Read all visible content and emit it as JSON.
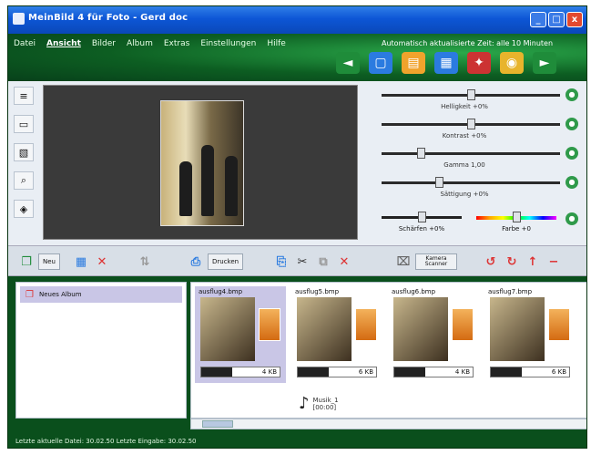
{
  "window": {
    "title": "MeinBild 4 für Foto - Gerd doc",
    "minimize": "_",
    "maximize": "□",
    "close": "x"
  },
  "menu": [
    "Datei",
    "Ansicht",
    "Bilder",
    "Album",
    "Extras",
    "Einstellungen",
    "Hilfe"
  ],
  "menu_selected_index": 1,
  "status": "Automatisch aktualisierte Zeit: alle 10 Minuten",
  "top_tools": [
    {
      "icon": "back-arrow-icon",
      "color": "#1f8c3a"
    },
    {
      "icon": "document-icon",
      "color": "#2b7be0"
    },
    {
      "icon": "folder-icon",
      "color": "#f0a32c"
    },
    {
      "icon": "image-icon",
      "color": "#2b7be0"
    },
    {
      "icon": "tools-icon",
      "color": "#cc3333"
    },
    {
      "icon": "disc-icon",
      "color": "#e8b42c"
    },
    {
      "icon": "forward-arrow-icon",
      "color": "#1f8c3a"
    }
  ],
  "left_tools": [
    {
      "icon": "list-icon"
    },
    {
      "icon": "picture-icon"
    },
    {
      "icon": "scan-icon"
    },
    {
      "icon": "magnify-icon"
    },
    {
      "icon": "camera-icon"
    }
  ],
  "sliders": [
    {
      "label": "Helligkeit +0%",
      "value": 0.5
    },
    {
      "label": "Kontrast +0%",
      "value": 0.5
    },
    {
      "label": "Gamma 1,00",
      "value": 0.22
    },
    {
      "label": "Sättigung +0%",
      "value": 0.32
    }
  ],
  "split_sliders": [
    {
      "label": "Schärfen +0%",
      "value": 0.5
    },
    {
      "label": "Farbe +0",
      "value": 0.5
    }
  ],
  "toolbar": {
    "new_album": "Neu",
    "grid": "▦",
    "delete": "✕",
    "sort": "⇅",
    "print_label": "Drucken",
    "copy": "⎘",
    "cut": "✂",
    "paste": "⧉",
    "remove": "✕",
    "scan_label": "Kamera Scanner",
    "rotate_left": "↺",
    "rotate_right": "↻",
    "up": "↑",
    "minus": "−"
  },
  "albums": [
    {
      "label": "Neues Album"
    }
  ],
  "thumbnails": [
    {
      "label": "ausflug4.bmp",
      "size": "4 KB",
      "selected": true
    },
    {
      "label": "ausflug5.bmp",
      "size": "6 KB",
      "selected": false
    },
    {
      "label": "ausflug6.bmp",
      "size": "4 KB",
      "selected": false
    },
    {
      "label": "ausflug7.bmp",
      "size": "6 KB",
      "selected": false
    }
  ],
  "music": {
    "title": "Musik_1",
    "duration": "[00:00]"
  },
  "footer": "Letzte aktuelle Datei: 30.02.50 Letzte Eingabe: 30.02.50"
}
